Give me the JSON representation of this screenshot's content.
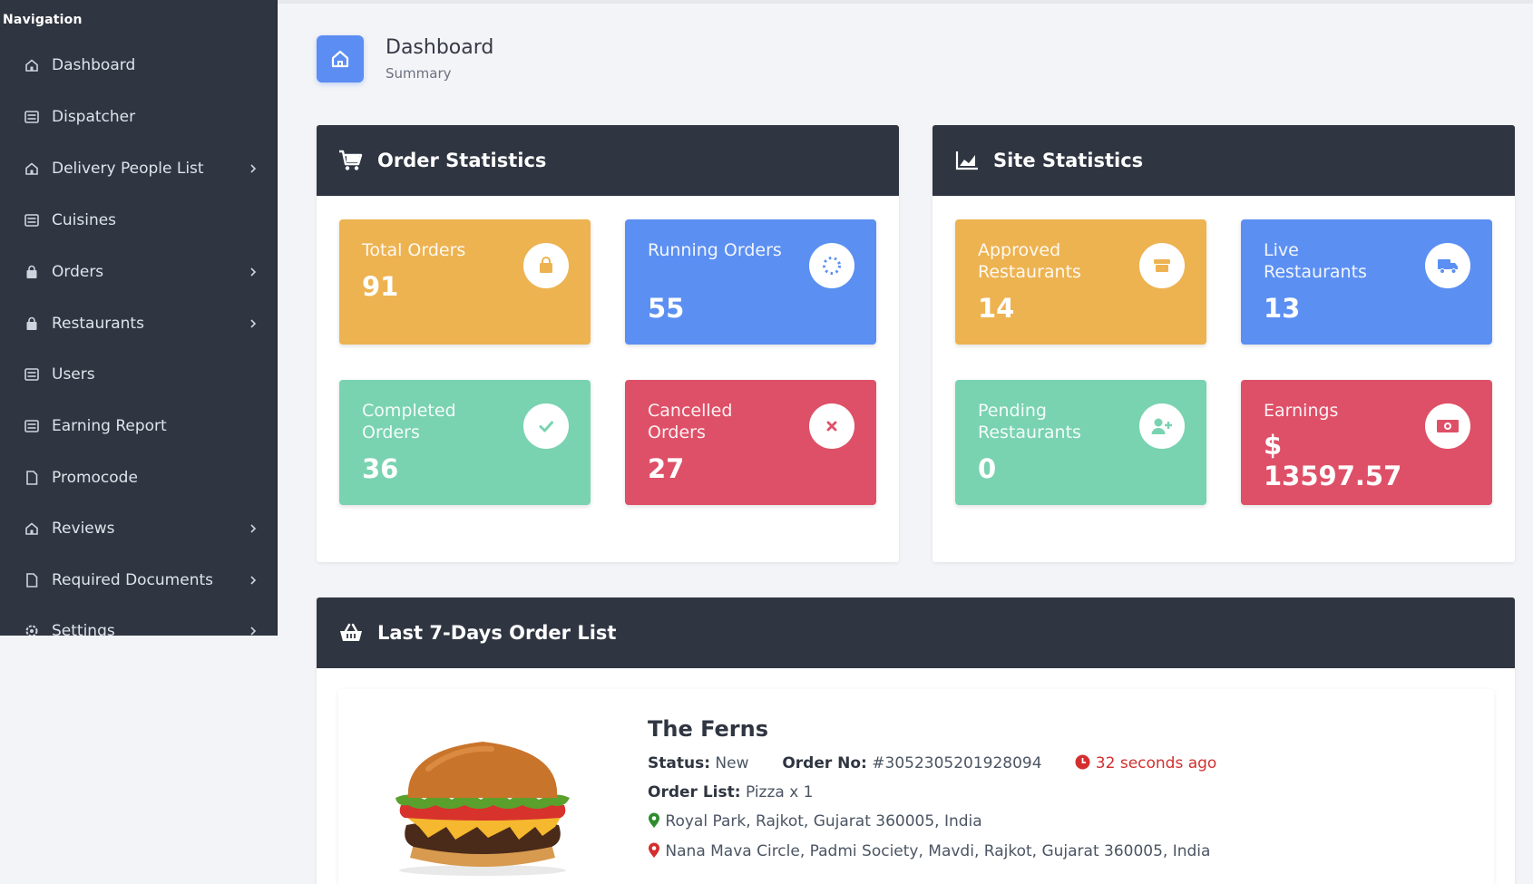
{
  "sidebar": {
    "title": "Navigation",
    "items": [
      {
        "label": "Dashboard",
        "icon": "home-icon",
        "chevron": false
      },
      {
        "label": "Dispatcher",
        "icon": "list-icon",
        "chevron": false
      },
      {
        "label": "Delivery People List",
        "icon": "home-icon",
        "chevron": true
      },
      {
        "label": "Cuisines",
        "icon": "list-icon",
        "chevron": false
      },
      {
        "label": "Orders",
        "icon": "bag-icon",
        "chevron": true
      },
      {
        "label": "Restaurants",
        "icon": "bag-icon",
        "chevron": true
      },
      {
        "label": "Users",
        "icon": "list-icon",
        "chevron": false
      },
      {
        "label": "Earning Report",
        "icon": "list-icon",
        "chevron": false
      },
      {
        "label": "Promocode",
        "icon": "document-icon",
        "chevron": false
      },
      {
        "label": "Reviews",
        "icon": "home-icon",
        "chevron": true
      },
      {
        "label": "Required Documents",
        "icon": "document-icon",
        "chevron": true
      },
      {
        "label": "Settings",
        "icon": "gear-icon",
        "chevron": true
      }
    ]
  },
  "header": {
    "title": "Dashboard",
    "subtitle": "Summary",
    "icon": "home-icon"
  },
  "order_statistics": {
    "title": "Order Statistics",
    "icon": "cart-icon",
    "cards": [
      {
        "label": "Total Orders",
        "value": "91",
        "color": "#edb351",
        "icon": "shopping-bag-icon"
      },
      {
        "label": "Running Orders",
        "value": "55",
        "color": "#5b8ff2",
        "icon": "spinner-icon"
      },
      {
        "label": "Completed Orders",
        "value": "36",
        "color": "#79d3b0",
        "icon": "check-icon"
      },
      {
        "label": "Cancelled Orders",
        "value": "27",
        "color": "#de5068",
        "icon": "close-icon"
      }
    ]
  },
  "site_statistics": {
    "title": "Site Statistics",
    "icon": "area-chart-icon",
    "cards": [
      {
        "label": "Approved Restaurants",
        "value": "14",
        "color": "#edb351",
        "icon": "store-icon"
      },
      {
        "label": "Live Restaurants",
        "value": "13",
        "color": "#5b8ff2",
        "icon": "truck-icon"
      },
      {
        "label": "Pending Restaurants",
        "value": "0",
        "color": "#79d3b0",
        "icon": "user-plus-icon"
      },
      {
        "label": "Earnings",
        "value_line1": "$",
        "value_line2": "13597.57",
        "color": "#de5068",
        "icon": "money-icon"
      }
    ]
  },
  "order_list": {
    "title": "Last 7-Days Order List",
    "icon": "basket-icon",
    "orders": [
      {
        "restaurant": "The Ferns",
        "status_label": "Status:",
        "status": "New",
        "order_no_label": "Order No:",
        "order_no": "#3052305201928094",
        "time_ago": "32 seconds ago",
        "order_list_label": "Order List:",
        "order_list": "Pizza x 1",
        "pickup_address": "Royal Park, Rajkot, Gujarat 360005, India",
        "drop_address": "Nana Mava Circle, Padmi Society, Mavdi, Rajkot, Gujarat 360005, India",
        "image": "burger-image"
      }
    ]
  }
}
